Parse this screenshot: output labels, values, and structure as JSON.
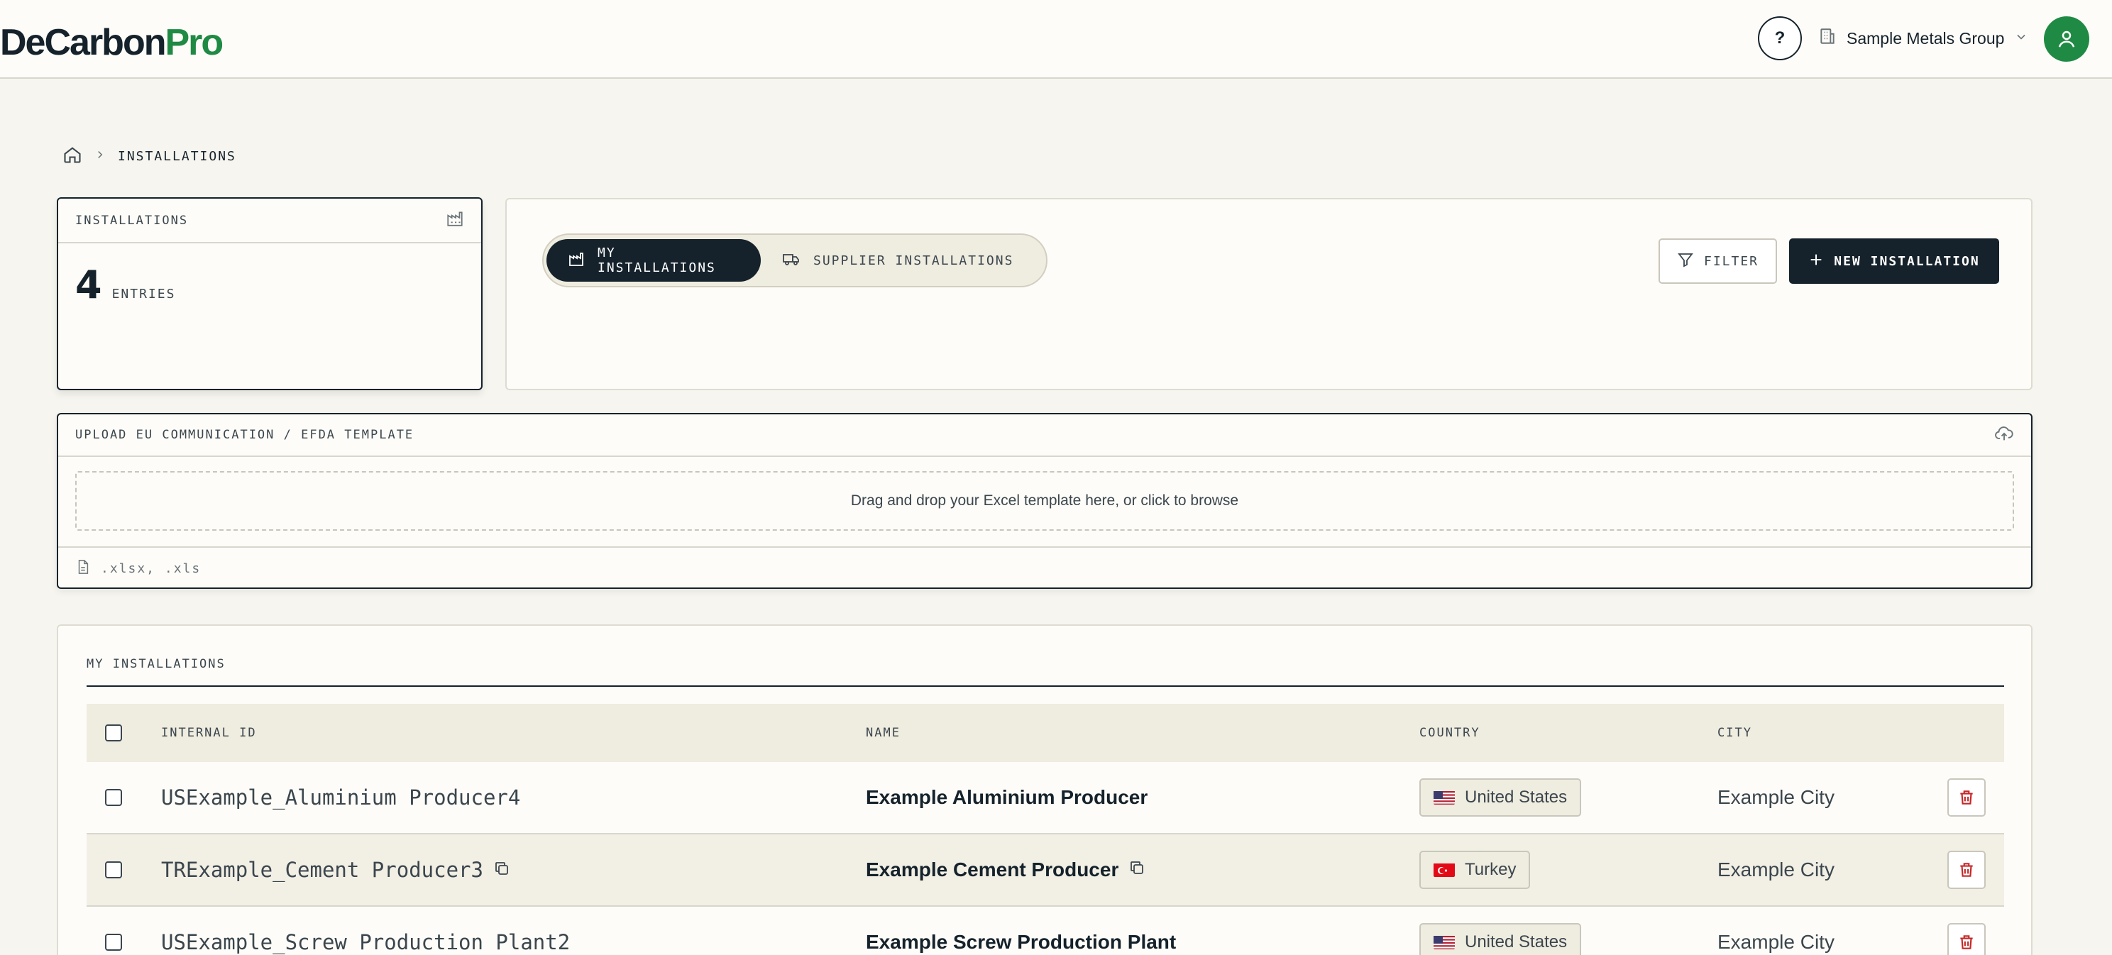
{
  "header": {
    "logo_main": "DeCarbon",
    "logo_accent": "Pro",
    "help_label": "?",
    "org_name": "Sample Metals Group"
  },
  "breadcrumb": {
    "current": "INSTALLATIONS"
  },
  "count_card": {
    "title": "INSTALLATIONS",
    "count": "4",
    "count_label": "ENTRIES"
  },
  "tabs": [
    {
      "label": "MY INSTALLATIONS",
      "active": true
    },
    {
      "label": "SUPPLIER INSTALLATIONS",
      "active": false
    }
  ],
  "toolbar": {
    "filter_label": "FILTER",
    "new_label": "NEW INSTALLATION"
  },
  "upload": {
    "title": "UPLOAD EU COMMUNICATION / EFDA TEMPLATE",
    "dropzone_text": "Drag and drop your Excel template here, or click to browse",
    "formats": ".xlsx, .xls"
  },
  "table": {
    "title": "MY INSTALLATIONS",
    "columns": [
      "INTERNAL ID",
      "NAME",
      "COUNTRY",
      "CITY"
    ],
    "rows": [
      {
        "internal_id": "USExample_Aluminium Producer4",
        "name": "Example Aluminium Producer",
        "country": "United States",
        "flag": "us-flag-icon",
        "city": "Example City"
      },
      {
        "internal_id": "TRExample_Cement Producer3",
        "name": "Example Cement Producer",
        "country": "Turkey",
        "flag": "tr-flag-icon",
        "city": "Example City"
      },
      {
        "internal_id": "USExample_Screw Production Plant2",
        "name": "Example Screw Production Plant",
        "country": "United States",
        "flag": "us-flag-icon",
        "city": "Example City"
      }
    ]
  },
  "colors": {
    "brand_green": "#1f8a44",
    "dark": "#15222b",
    "background": "#f6f5ef",
    "delete_red": "#c62828"
  }
}
